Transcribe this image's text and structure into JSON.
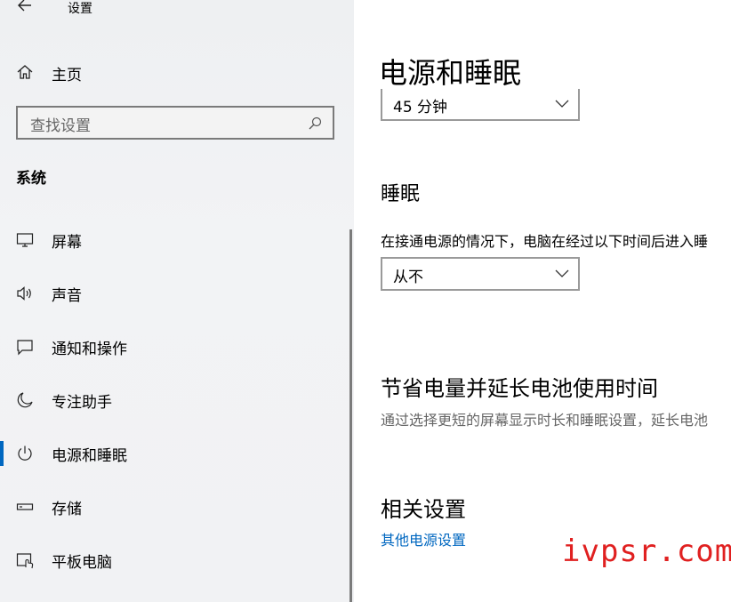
{
  "window": {
    "title": "设置"
  },
  "sidebar": {
    "home_label": "主页",
    "search": {
      "placeholder": "查找设置"
    },
    "section_title": "系统",
    "items": [
      {
        "label": "屏幕",
        "icon": "monitor-icon",
        "active": false
      },
      {
        "label": "声音",
        "icon": "speaker-icon",
        "active": false
      },
      {
        "label": "通知和操作",
        "icon": "notification-icon",
        "active": false
      },
      {
        "label": "专注助手",
        "icon": "moon-icon",
        "active": false
      },
      {
        "label": "电源和睡眠",
        "icon": "power-icon",
        "active": true
      },
      {
        "label": "存储",
        "icon": "storage-icon",
        "active": false
      },
      {
        "label": "平板电脑",
        "icon": "tablet-icon",
        "active": false
      }
    ]
  },
  "main": {
    "title": "电源和睡眠",
    "screen_dropdown": {
      "value": "45 分钟"
    },
    "sleep": {
      "heading": "睡眠",
      "description": "在接通电源的情况下，电脑在经过以下时间后进入睡",
      "dropdown": {
        "value": "从不"
      }
    },
    "battery": {
      "heading": "节省电量并延长电池使用时间",
      "description": "通过选择更短的屏幕显示时长和睡眠设置，延长电池"
    },
    "related": {
      "heading": "相关设置",
      "link": "其他电源设置"
    }
  },
  "watermark": "ivpsr.com",
  "colors": {
    "accent": "#0067c0",
    "watermark": "#e02020"
  }
}
